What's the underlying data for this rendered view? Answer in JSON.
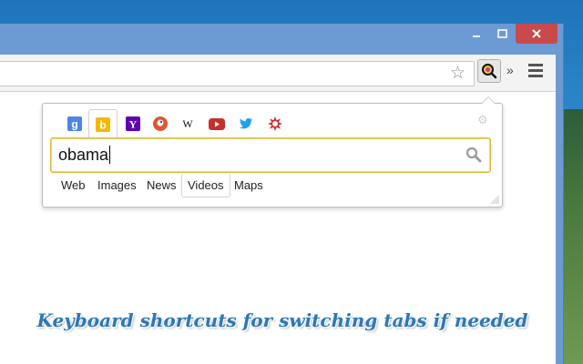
{
  "window": {
    "controls": {
      "minimize_icon": "minimize-icon",
      "maximize_icon": "maximize-icon",
      "close_icon": "close-icon"
    }
  },
  "toolbar": {
    "icons": [
      "bookmark-star-icon",
      "search-extension-icon",
      "extensions-overflow-icon",
      "chrome-menu-icon"
    ]
  },
  "popup": {
    "engines": [
      {
        "name": "google",
        "icon": "google-icon",
        "active": false,
        "color": "#4a86e8"
      },
      {
        "name": "bing",
        "icon": "bing-icon",
        "active": true,
        "color": "#f5b800"
      },
      {
        "name": "yahoo",
        "icon": "yahoo-icon",
        "active": false,
        "color": "#5f00b5"
      },
      {
        "name": "duckduckgo",
        "icon": "duckduckgo-icon",
        "active": false,
        "color": "#de5833"
      },
      {
        "name": "wikipedia",
        "icon": "wikipedia-icon",
        "active": false,
        "color": "#111111"
      },
      {
        "name": "youtube",
        "icon": "youtube-icon",
        "active": false,
        "color": "#c4302b"
      },
      {
        "name": "twitter",
        "icon": "twitter-icon",
        "active": false,
        "color": "#1da1f2"
      },
      {
        "name": "yelp",
        "icon": "yelp-icon",
        "active": false,
        "color": "#d32323"
      }
    ],
    "query": "obama",
    "tabs": [
      {
        "label": "Web",
        "selected": false
      },
      {
        "label": "Images",
        "selected": false
      },
      {
        "label": "News",
        "selected": false
      },
      {
        "label": "Videos",
        "selected": true
      },
      {
        "label": "Maps",
        "selected": false
      }
    ]
  },
  "tagline": "Keyboard shortcuts for switching tabs if needed",
  "colors": {
    "accent": "#e2b93a",
    "tagline": "#2b78b7",
    "close_button": "#c94a4a"
  }
}
